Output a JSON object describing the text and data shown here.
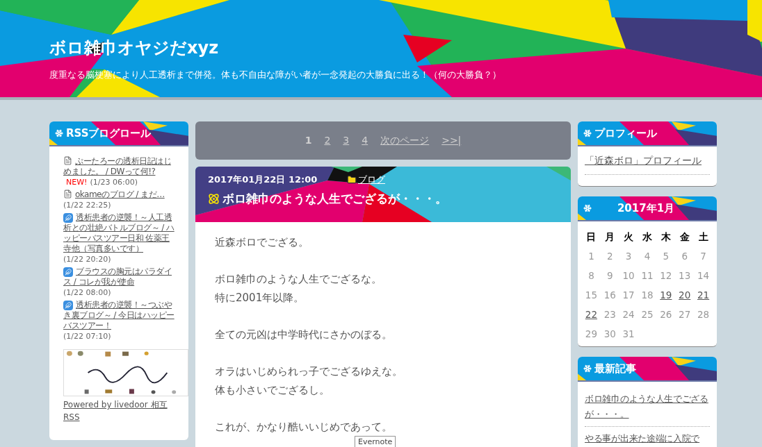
{
  "header": {
    "title": "ボロ雑巾オヤジだxyz",
    "subtitle": "度重なる脳梗塞により人工透析まで併発。体も不自由な障がい者が一念発起の大勝負に出る！（何の大勝負？）"
  },
  "left_sidebar": {
    "rss_widget": {
      "title": "RSSブログロール",
      "items": [
        {
          "kind": "page",
          "title": "ぷーたろーの透析日記はじめました。 / DWって何!?",
          "badge": "NEW!",
          "time": "(1/23 06:00)"
        },
        {
          "kind": "page",
          "title": "okameのブログ / まだ…",
          "time": "(1/22 22:25)"
        },
        {
          "kind": "feather",
          "title": "透析患者の逆襲！～人工透析との壮絶バトルブログ～ / ハッピーバスツアー日和 佐薬王寺他（写真多いです）",
          "time": "(1/22 20:20)"
        },
        {
          "kind": "feather",
          "title": "ブラウスの胸元はパラダイス / コレが我が使命",
          "time": "(1/22 08:00)"
        },
        {
          "kind": "feather",
          "title": "透析患者の逆襲！～つぶやき裏ブログ～ / 今日はハッピーバスツアー！",
          "time": "(1/22 07:10)"
        }
      ],
      "powered_link": "Powered by livedoor 相互RSS"
    }
  },
  "pagination": [
    {
      "label": "1",
      "selected": true
    },
    {
      "label": "2",
      "selected": false
    },
    {
      "label": "3",
      "selected": false
    },
    {
      "label": "4",
      "selected": false
    },
    {
      "label": "次のページ",
      "selected": false
    },
    {
      "label": ">>|",
      "selected": false
    }
  ],
  "post": {
    "datetime": "2017年01月22日 12:00",
    "category": "ブログ",
    "title": "ボロ雑巾のような人生でござるが・・・。",
    "paragraphs": [
      [
        "近森ボロでござる。"
      ],
      [
        "ボロ雑巾のような人生でござるな。",
        "特に2001年以降。"
      ],
      [
        "全ての元凶は中学時代にさかのぼる。"
      ],
      [
        "オラはいじめられっ子でござるゆえな。",
        "体も小さいでござるし。"
      ],
      [
        "これが、かなり酷いいじめであって。"
      ]
    ]
  },
  "tooltip": "Evernote",
  "right_sidebar": {
    "profile_widget": {
      "title": "プロフィール",
      "link": "「近森ボロ」プロフィール"
    },
    "calendar_widget": {
      "title": "2017年1月",
      "weekdays": [
        "日",
        "月",
        "火",
        "水",
        "木",
        "金",
        "土"
      ],
      "weeks": [
        [
          {
            "day": "1",
            "linked": false
          },
          {
            "day": "2",
            "linked": false
          },
          {
            "day": "3",
            "linked": false
          },
          {
            "day": "4",
            "linked": false
          },
          {
            "day": "5",
            "linked": false
          },
          {
            "day": "6",
            "linked": false
          },
          {
            "day": "7",
            "linked": false
          }
        ],
        [
          {
            "day": "8",
            "linked": false
          },
          {
            "day": "9",
            "linked": false
          },
          {
            "day": "10",
            "linked": false
          },
          {
            "day": "11",
            "linked": false
          },
          {
            "day": "12",
            "linked": false
          },
          {
            "day": "13",
            "linked": false
          },
          {
            "day": "14",
            "linked": false
          }
        ],
        [
          {
            "day": "15",
            "linked": false
          },
          {
            "day": "16",
            "linked": false
          },
          {
            "day": "17",
            "linked": false
          },
          {
            "day": "18",
            "linked": false
          },
          {
            "day": "19",
            "linked": true
          },
          {
            "day": "20",
            "linked": true
          },
          {
            "day": "21",
            "linked": true
          }
        ],
        [
          {
            "day": "22",
            "linked": true
          },
          {
            "day": "23",
            "linked": false
          },
          {
            "day": "24",
            "linked": false
          },
          {
            "day": "25",
            "linked": false
          },
          {
            "day": "26",
            "linked": false
          },
          {
            "day": "27",
            "linked": false
          },
          {
            "day": "28",
            "linked": false
          }
        ],
        [
          {
            "day": "29",
            "linked": false
          },
          {
            "day": "30",
            "linked": false
          },
          {
            "day": "31",
            "linked": false
          }
        ]
      ]
    },
    "recent_widget": {
      "title": "最新記事",
      "items": [
        "ボロ雑巾のような人生でござるが・・・。",
        "やる事が出来た途端に入院で"
      ]
    }
  }
}
